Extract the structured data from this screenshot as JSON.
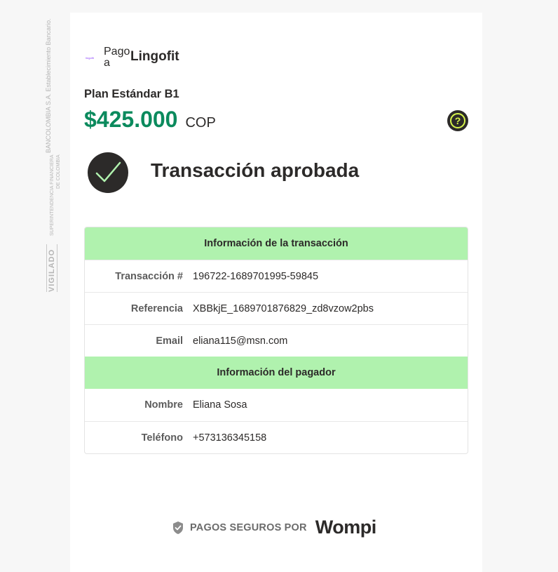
{
  "regulatory": {
    "bank_line": "BANCOLOMBIA S.A. Establecimiento Bancario.",
    "super_line_1": "SUPERINTENDENCIA FINANCIERA",
    "super_line_2": "DE COLOMBIA",
    "vigilado": "VIGILADO"
  },
  "merchant": {
    "logo_text": "lingofit",
    "pago_a": "Pago a",
    "name": "Lingofit"
  },
  "plan": {
    "name": "Plan Estándar B1",
    "amount": "$425.000",
    "currency": "COP"
  },
  "help_icon": "question-mark-icon",
  "status": {
    "icon": "check-icon",
    "text": "Transacción aprobada"
  },
  "transaction_info": {
    "header": "Información de la transacción",
    "rows": [
      {
        "label": "Transacción #",
        "value": "196722-1689701995-59845"
      },
      {
        "label": "Referencia",
        "value": "XBBkjE_1689701876829_zd8vzow2pbs"
      },
      {
        "label": "Email",
        "value": "eliana115@msn.com"
      }
    ]
  },
  "payer_info": {
    "header": "Información del pagador",
    "rows": [
      {
        "label": "Nombre",
        "value": "Eliana Sosa"
      },
      {
        "label": "Teléfono",
        "value": "+573136345158"
      }
    ]
  },
  "footer": {
    "shield_icon": "shield-icon",
    "secure_text": "PAGOS SEGUROS POR",
    "brand": "Wompi"
  },
  "colors": {
    "amount_green": "#0b8a5d",
    "section_header_bg": "#b0f2ae",
    "dark": "#2c2a29",
    "help_accent": "#d7f54c"
  }
}
